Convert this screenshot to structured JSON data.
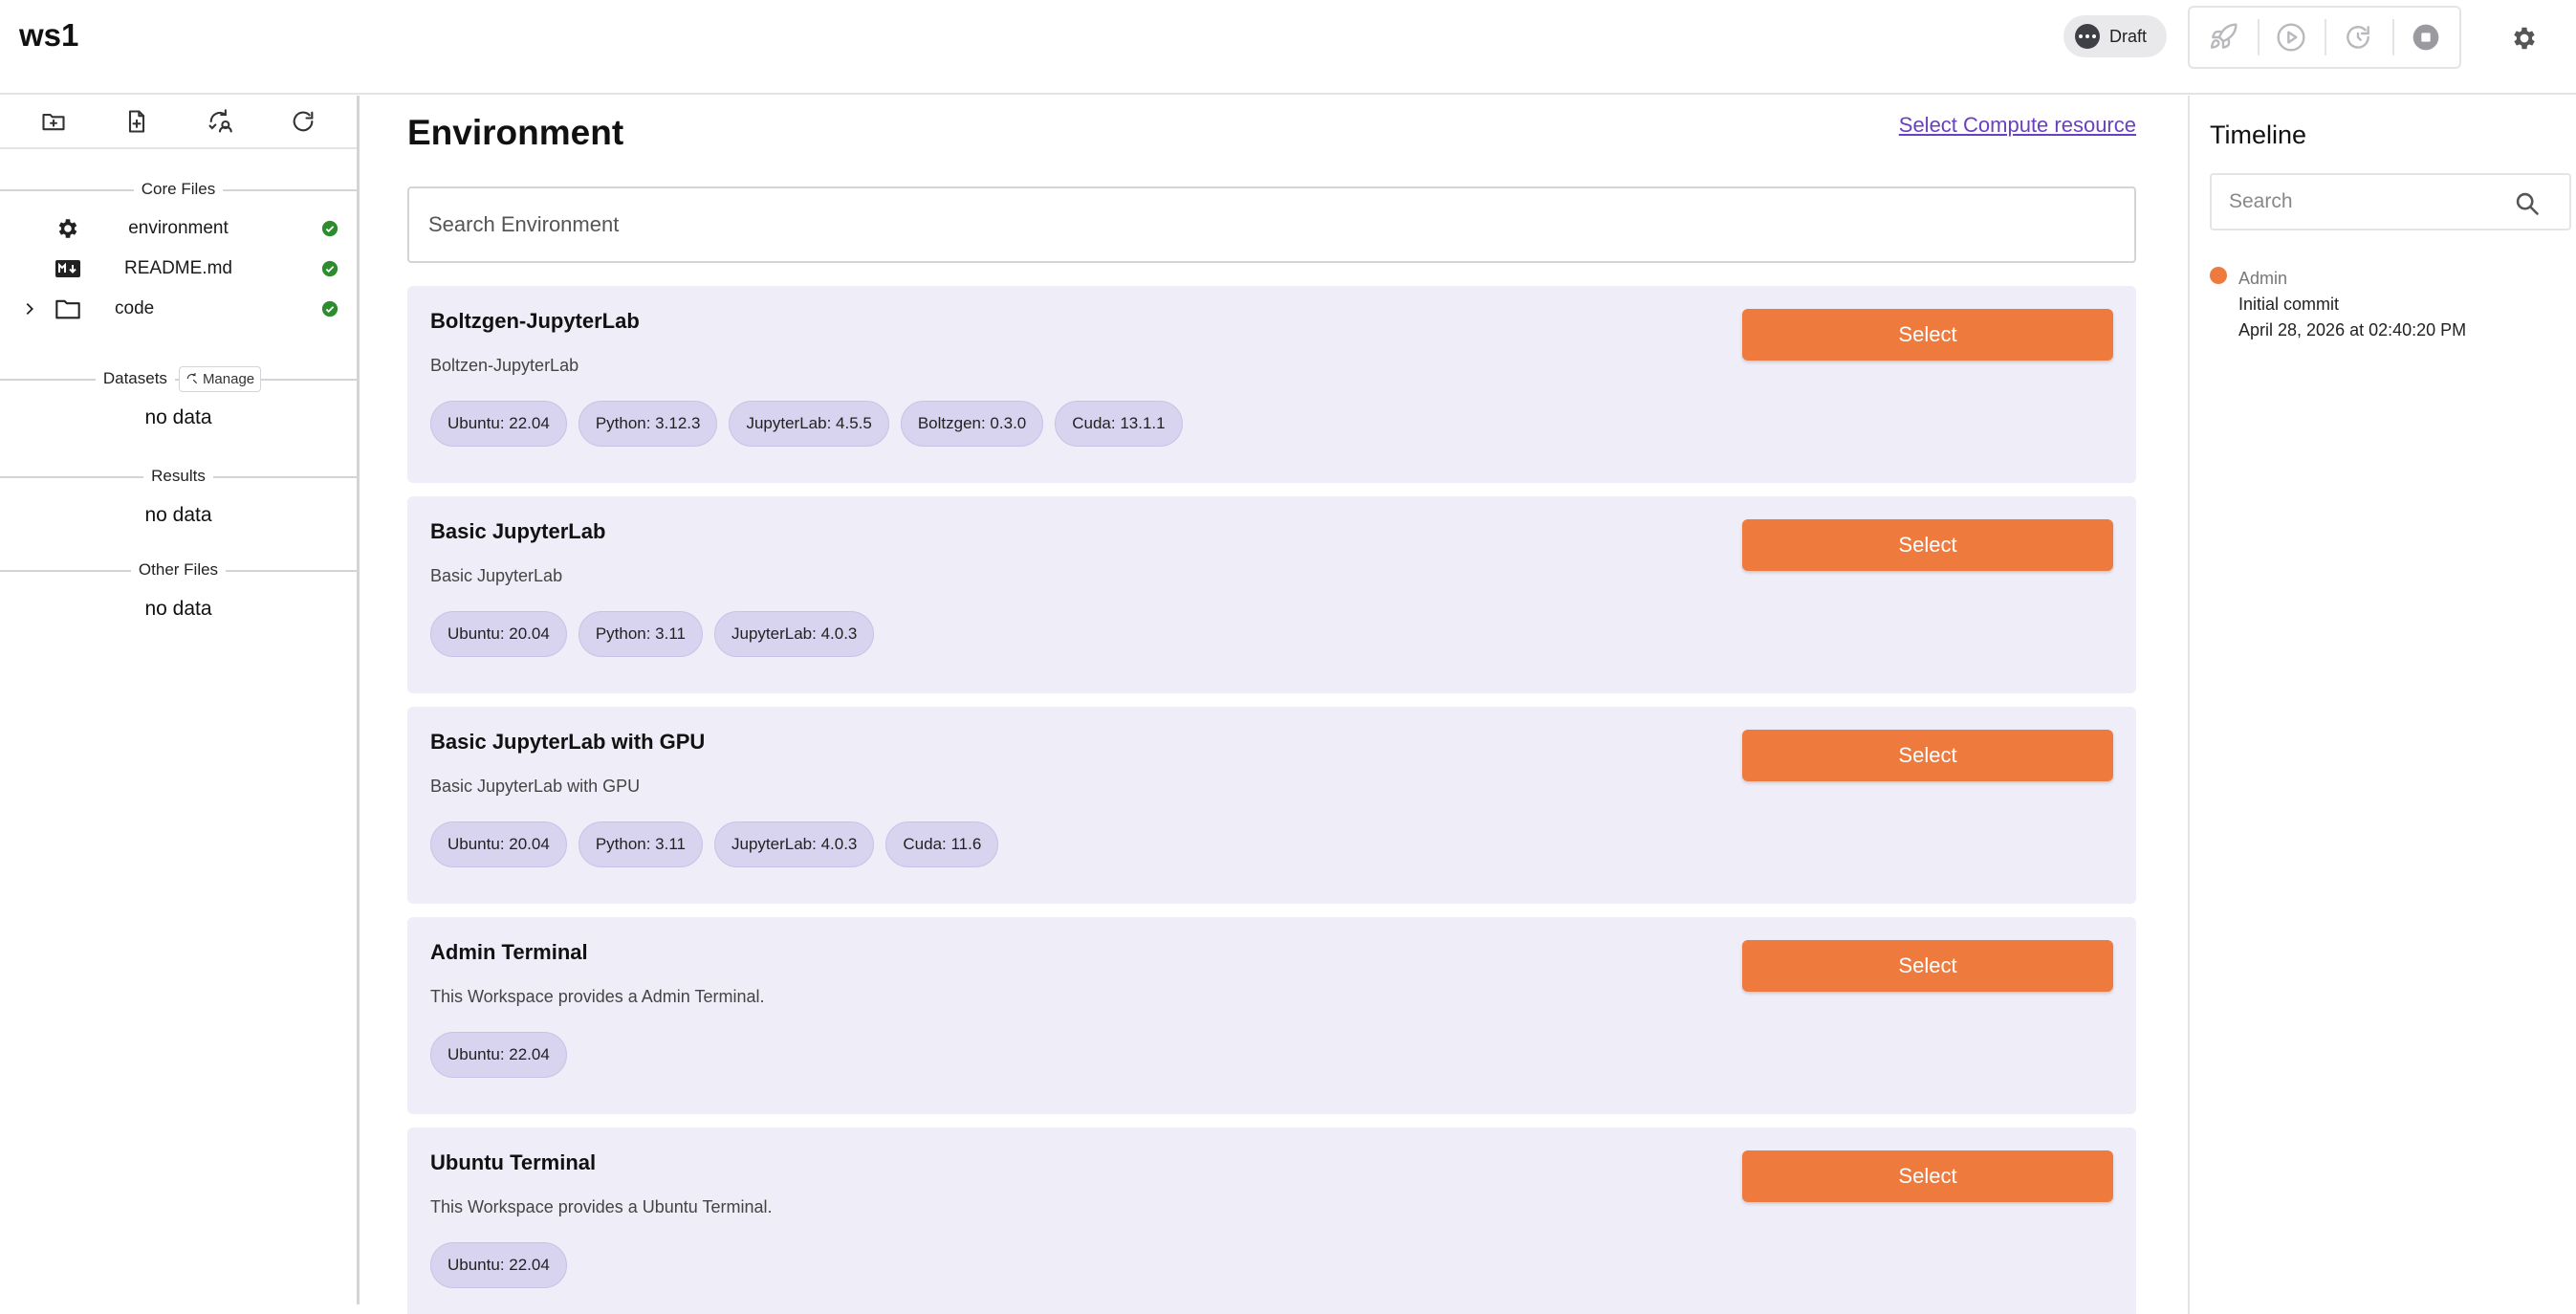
{
  "header": {
    "workspace_title": "ws1",
    "status_label": "Draft",
    "actions": [
      "rocket-icon",
      "play-icon",
      "restart-icon",
      "stop-icon"
    ],
    "settings_icon": "gear-icon"
  },
  "sidebar": {
    "toolbar": [
      "new-folder-icon",
      "new-file-icon",
      "git-sync-icon",
      "refresh-icon"
    ],
    "core_files": {
      "label": "Core Files",
      "items": [
        {
          "name": "environment",
          "icon": "gear-icon",
          "status": "check-circle-icon"
        },
        {
          "name": "README.md",
          "icon": "markdown-icon",
          "status": "check-circle-icon"
        },
        {
          "name": "code",
          "icon": "folder-icon",
          "status": "check-circle-icon"
        }
      ]
    },
    "datasets": {
      "label": "Datasets",
      "manage_label": "Manage",
      "empty": "no data"
    },
    "results": {
      "label": "Results",
      "empty": "no data"
    },
    "other_files": {
      "label": "Other Files",
      "empty": "no data"
    }
  },
  "main": {
    "title": "Environment",
    "compute_link": "Select Compute resource",
    "search_placeholder": "Search Environment",
    "select_label": "Select",
    "environments": [
      {
        "name": "Boltzgen-JupyterLab",
        "description": "Boltzen-JupyterLab",
        "tags": [
          "Ubuntu: 22.04",
          "Python: 3.12.3",
          "JupyterLab: 4.5.5",
          "Boltzgen: 0.3.0",
          "Cuda: 13.1.1"
        ]
      },
      {
        "name": "Basic JupyterLab",
        "description": "Basic JupyterLab",
        "tags": [
          "Ubuntu: 20.04",
          "Python: 3.11",
          "JupyterLab: 4.0.3"
        ]
      },
      {
        "name": "Basic JupyterLab with GPU",
        "description": "Basic JupyterLab with GPU",
        "tags": [
          "Ubuntu: 20.04",
          "Python: 3.11",
          "JupyterLab: 4.0.3",
          "Cuda: 11.6"
        ]
      },
      {
        "name": "Admin Terminal",
        "description": "This Workspace provides a Admin Terminal.",
        "tags": [
          "Ubuntu: 22.04"
        ]
      },
      {
        "name": "Ubuntu Terminal",
        "description": "This Workspace provides a Ubuntu Terminal.",
        "tags": [
          "Ubuntu: 22.04"
        ]
      }
    ]
  },
  "timeline": {
    "title": "Timeline",
    "search_placeholder": "Search",
    "entries": [
      {
        "user": "Admin",
        "message": "Initial commit",
        "time": "April 28, 2026 at 02:40:20 PM"
      }
    ]
  },
  "colors": {
    "accent": "#ee7a3e",
    "card_bg": "#efedf8",
    "tag_bg": "#d8d3ee",
    "link": "#6a3fc1",
    "success": "#2e8b2e"
  }
}
